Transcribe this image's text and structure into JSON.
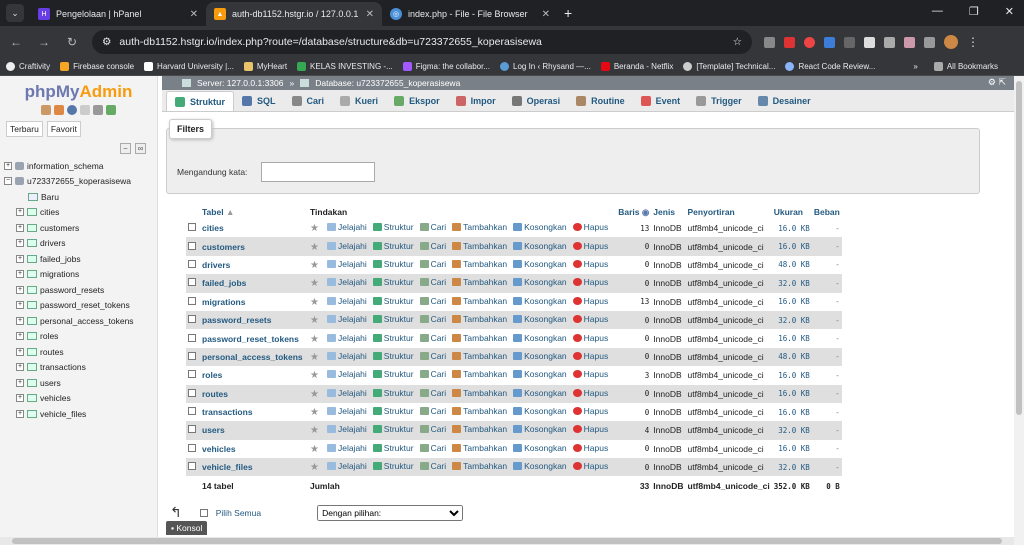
{
  "browser": {
    "tabs": [
      {
        "title": "Pengelolaan | hPanel",
        "color": "#673de6",
        "icon": "hpanel-icon"
      },
      {
        "title": "auth-db1152.hstgr.io / 127.0.0.1",
        "color": "#f89c0e",
        "icon": "phpmyadmin-icon"
      },
      {
        "title": "index.php - File - File Browser",
        "color": "#4a90d9",
        "icon": "globe-icon"
      }
    ],
    "url": "auth-db1152.hstgr.io/index.php?route=/database/structure&db=u723372655_koperasisewa",
    "bookmarks": [
      "Craftivity",
      "Firebase console",
      "Harvard University |...",
      "MyHeart",
      "KELAS INVESTING -...",
      "Figma: the collabor...",
      "Log In ‹ Rhysand —...",
      "Beranda - Netflix",
      "[Template] Technical...",
      "React Code Review..."
    ],
    "all_bookmarks": "All Bookmarks"
  },
  "sidebar": {
    "logo_php": "php",
    "logo_my": "My",
    "logo_admin": "Admin",
    "tab_recent": "Terbaru",
    "tab_favorite": "Favorit",
    "databases": [
      "information_schema",
      "u723372655_koperasisewa"
    ],
    "new_label": "Baru",
    "tables": [
      "cities",
      "customers",
      "drivers",
      "failed_jobs",
      "migrations",
      "password_resets",
      "password_reset_tokens",
      "personal_access_tokens",
      "roles",
      "routes",
      "transactions",
      "users",
      "vehicles",
      "vehicle_files"
    ]
  },
  "breadcrumb": {
    "server": "Server: 127.0.0.1:3306",
    "separator": "»",
    "database": "Database: u723372655_koperasisewa"
  },
  "menu": [
    "Struktur",
    "SQL",
    "Cari",
    "Kueri",
    "Ekspor",
    "Impor",
    "Operasi",
    "Routine",
    "Event",
    "Trigger",
    "Desainer"
  ],
  "filters": {
    "legend": "Filters",
    "label": "Mengandung kata:",
    "value": ""
  },
  "table": {
    "headers": {
      "name": "Tabel",
      "actions": "Tindakan",
      "rows": "Baris",
      "type": "Jenis",
      "collation": "Penyortiran",
      "size": "Ukuran",
      "overhead": "Beban"
    },
    "action_labels": [
      "Jelajahi",
      "Struktur",
      "Cari",
      "Tambahkan",
      "Kosongkan",
      "Hapus"
    ],
    "rows": [
      {
        "name": "cities",
        "rows": "13",
        "type": "InnoDB",
        "collation": "utf8mb4_unicode_ci",
        "size": "16.0 KB",
        "overhead": "-"
      },
      {
        "name": "customers",
        "rows": "0",
        "type": "InnoDB",
        "collation": "utf8mb4_unicode_ci",
        "size": "16.0 KB",
        "overhead": "-"
      },
      {
        "name": "drivers",
        "rows": "0",
        "type": "InnoDB",
        "collation": "utf8mb4_unicode_ci",
        "size": "48.0 KB",
        "overhead": "-"
      },
      {
        "name": "failed_jobs",
        "rows": "0",
        "type": "InnoDB",
        "collation": "utf8mb4_unicode_ci",
        "size": "32.0 KB",
        "overhead": "-"
      },
      {
        "name": "migrations",
        "rows": "13",
        "type": "InnoDB",
        "collation": "utf8mb4_unicode_ci",
        "size": "16.0 KB",
        "overhead": "-"
      },
      {
        "name": "password_resets",
        "rows": "0",
        "type": "InnoDB",
        "collation": "utf8mb4_unicode_ci",
        "size": "32.0 KB",
        "overhead": "-"
      },
      {
        "name": "password_reset_tokens",
        "rows": "0",
        "type": "InnoDB",
        "collation": "utf8mb4_unicode_ci",
        "size": "16.0 KB",
        "overhead": "-"
      },
      {
        "name": "personal_access_tokens",
        "rows": "0",
        "type": "InnoDB",
        "collation": "utf8mb4_unicode_ci",
        "size": "48.0 KB",
        "overhead": "-"
      },
      {
        "name": "roles",
        "rows": "3",
        "type": "InnoDB",
        "collation": "utf8mb4_unicode_ci",
        "size": "16.0 KB",
        "overhead": "-"
      },
      {
        "name": "routes",
        "rows": "0",
        "type": "InnoDB",
        "collation": "utf8mb4_unicode_ci",
        "size": "16.0 KB",
        "overhead": "-"
      },
      {
        "name": "transactions",
        "rows": "0",
        "type": "InnoDB",
        "collation": "utf8mb4_unicode_ci",
        "size": "16.0 KB",
        "overhead": "-"
      },
      {
        "name": "users",
        "rows": "4",
        "type": "InnoDB",
        "collation": "utf8mb4_unicode_ci",
        "size": "32.0 KB",
        "overhead": "-"
      },
      {
        "name": "vehicles",
        "rows": "0",
        "type": "InnoDB",
        "collation": "utf8mb4_unicode_ci",
        "size": "16.0 KB",
        "overhead": "-"
      },
      {
        "name": "vehicle_files",
        "rows": "0",
        "type": "InnoDB",
        "collation": "utf8mb4_unicode_ci",
        "size": "32.0 KB",
        "overhead": "-"
      }
    ],
    "footer": {
      "count": "14 tabel",
      "label": "Jumlah",
      "rows": "33",
      "type": "InnoDB",
      "collation": "utf8mb4_unicode_ci",
      "size": "352.0 KB",
      "overhead": "0 B"
    }
  },
  "bulk": {
    "select_all": "Pilih Semua",
    "with_selected": "Dengan pilihan:"
  },
  "console_label": "Konsol"
}
